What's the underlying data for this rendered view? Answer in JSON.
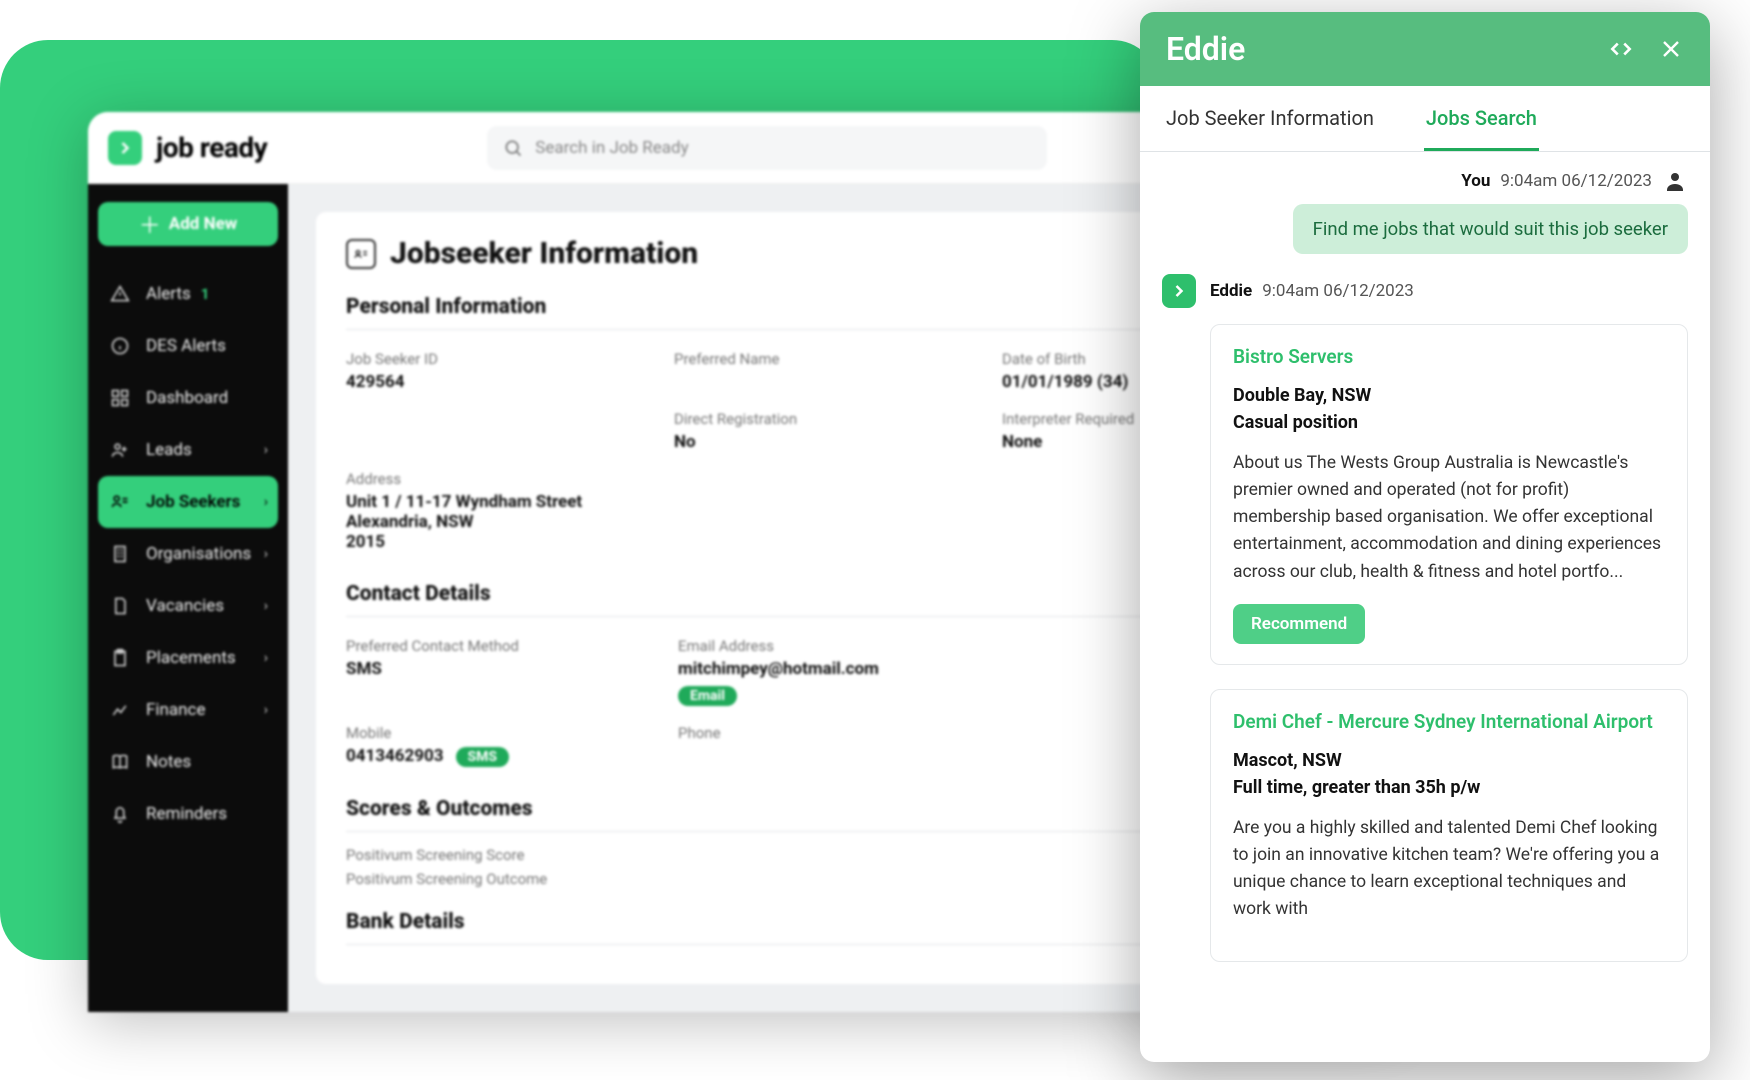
{
  "brand": "job ready",
  "search_placeholder": "Search in Job Ready",
  "sidebar": {
    "add_new": "Add New",
    "items": [
      {
        "label": "Alerts",
        "badge": "1"
      },
      {
        "label": "DES Alerts"
      },
      {
        "label": "Dashboard"
      },
      {
        "label": "Leads",
        "chevron": true
      },
      {
        "label": "Job Seekers",
        "chevron": true,
        "active": true
      },
      {
        "label": "Organisations",
        "chevron": true
      },
      {
        "label": "Vacancies",
        "chevron": true
      },
      {
        "label": "Placements",
        "chevron": true
      },
      {
        "label": "Finance",
        "chevron": true
      },
      {
        "label": "Notes"
      },
      {
        "label": "Reminders"
      }
    ]
  },
  "page": {
    "title": "Jobseeker Information",
    "sections": {
      "personal": "Personal Information",
      "contact": "Contact Details",
      "scores": "Scores & Outcomes",
      "bank": "Bank Details"
    },
    "fields": {
      "job_seeker_id_label": "Job Seeker ID",
      "job_seeker_id": "429564",
      "preferred_name_label": "Preferred Name",
      "preferred_name": "",
      "dob_label": "Date of Birth",
      "dob": "01/01/1989 (34)",
      "direct_reg_label": "Direct Registration",
      "direct_reg": "No",
      "interpreter_label": "Interpreter Required",
      "interpreter": "None",
      "address_label": "Address",
      "address_line1": "Unit 1 / 11-17 Wyndham Street",
      "address_line2": "Alexandria, NSW",
      "address_line3": "2015",
      "contact_method_label": "Preferred Contact Method",
      "contact_method": "SMS",
      "email_label": "Email Address",
      "email": "mitchimpey@hotmail.com",
      "email_pill": "Email",
      "mobile_label": "Mobile",
      "mobile": "0413462903",
      "mobile_pill": "SMS",
      "phone_label": "Phone",
      "pos_score_label": "Positivum Screening Score",
      "pos_outcome_label": "Positivum Screening Outcome"
    }
  },
  "eddie": {
    "title": "Eddie",
    "tabs": {
      "info": "Job Seeker Information",
      "jobs": "Jobs Search"
    },
    "you": {
      "who": "You",
      "time": "9:04am 06/12/2023",
      "text": "Find me jobs that would suit this job seeker"
    },
    "bot": {
      "who": "Eddie",
      "time": "9:04am 06/12/2023"
    },
    "results": [
      {
        "title": "Bistro Servers",
        "location": "Double Bay, NSW",
        "terms": "Casual position",
        "desc": "About us The Wests Group Australia is Newcastle's premier owned and operated (not for profit) membership based organisation. We offer exceptional entertainment, accommodation and dining experiences across our club, health & fitness and hotel portfo...",
        "cta": "Recommend"
      },
      {
        "title": "Demi Chef - Mercure Sydney International Airport",
        "location": "Mascot, NSW",
        "terms": "Full time, greater than 35h p/w",
        "desc": "Are you a highly skilled and talented Demi Chef looking to join an innovative kitchen team? We're offering you a unique chance to learn exceptional techniques and work with"
      }
    ]
  }
}
